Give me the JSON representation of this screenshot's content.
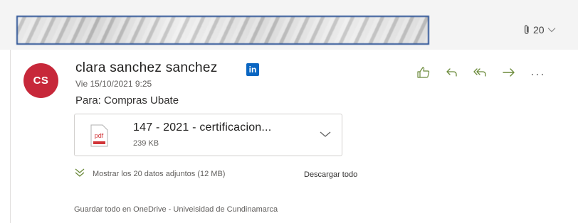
{
  "message": {
    "attachment_count": "20",
    "sender": {
      "initials": "CS",
      "name": "clara sanchez sanchez",
      "linkedin_badge": "in"
    },
    "date": "Vie 15/10/2021 9:25",
    "to": "Para:  Compras Ubate",
    "attachment": {
      "icon_label": "pdf",
      "name": "147 - 2021 - certificacion...",
      "size": "239 KB"
    },
    "show_all": "Mostrar los 20 datos adjuntos (12 MB)",
    "download_all": "Descargar todo",
    "save_all": "Guardar todo en OneDrive - Univeisidad de Cundinamarca"
  },
  "icons": {
    "attachment": "paperclip-icon",
    "attachment_chevron": "chevron-down-icon",
    "actions": [
      "like-icon",
      "reply-icon",
      "reply-all-icon",
      "forward-icon",
      "more-icon"
    ],
    "expand": "double-chevron-down-icon"
  },
  "colors": {
    "avatar": "#c7283a",
    "linkedin": "#0a66c2",
    "redaction_border": "#2f5597",
    "pdf": "#d13438",
    "action_icons": "#6b8a3a"
  }
}
